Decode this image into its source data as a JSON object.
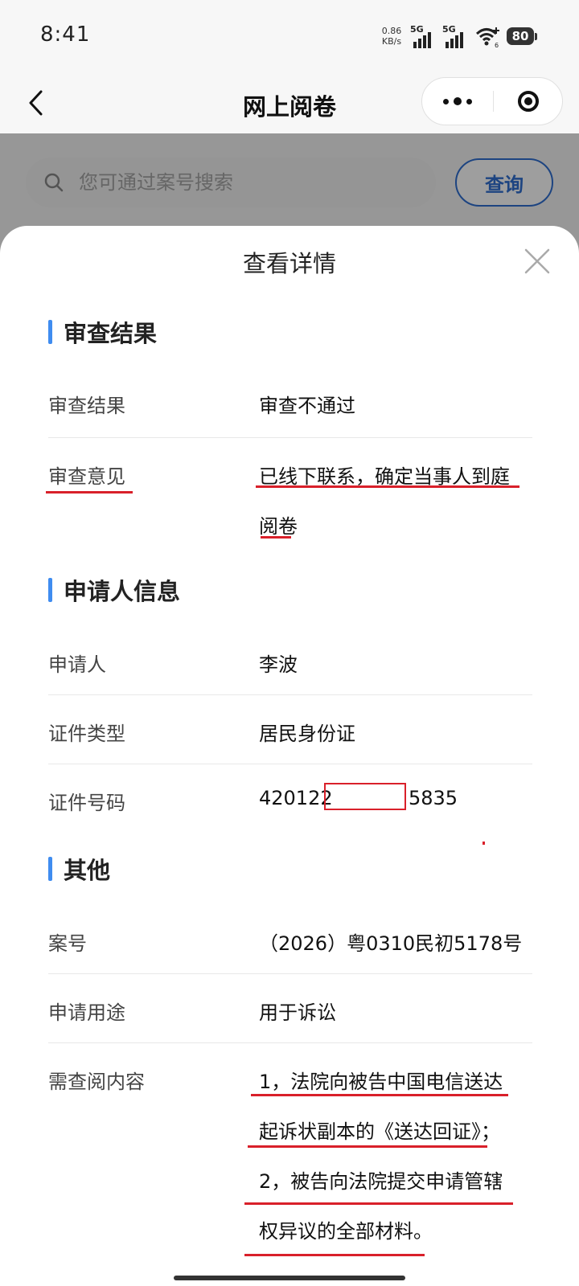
{
  "status_bar": {
    "time": "8:41",
    "net_speed_value": "0.86",
    "net_speed_unit": "KB/s",
    "sim1_label": "5G",
    "sim2_label": "5G",
    "wifi_badge": "6",
    "battery": "80"
  },
  "nav": {
    "title": "网上阅卷",
    "back_icon": "chevron-left-icon",
    "more_icon": "more-dots-icon",
    "close_icon": "target-circle-icon"
  },
  "search": {
    "placeholder": "您可通过案号搜索",
    "button_label": "查询"
  },
  "sheet": {
    "title": "查看详情",
    "sections": {
      "review": {
        "title": "审查结果",
        "result_label": "审查结果",
        "result_value": "审查不通过",
        "opinion_label": "审查意见",
        "opinion_line1": "已线下联系，确定当事人到庭",
        "opinion_line2": "阅卷"
      },
      "applicant": {
        "title": "申请人信息",
        "name_label": "申请人",
        "name_value": "李波",
        "id_type_label": "证件类型",
        "id_type_value": "居民身份证",
        "id_number_label": "证件号码",
        "id_number_prefix": "420122",
        "id_number_suffix": "5835"
      },
      "other": {
        "title": "其他",
        "case_label": "案号",
        "case_value": "（2026）粤0310民初5178号",
        "purpose_label": "申请用途",
        "purpose_value": "用于诉讼",
        "content_label": "需查阅内容",
        "content_lines": [
          "1，法院向被告中国电信送达",
          "起诉状副本的《送达回证》；",
          "2，被告向法院提交申请管辖",
          "权异议的全部材料。"
        ]
      }
    }
  },
  "colors": {
    "accent_blue": "#3f8cf0",
    "button_blue": "#2f6fd0",
    "annotation_red": "#d9202a"
  }
}
